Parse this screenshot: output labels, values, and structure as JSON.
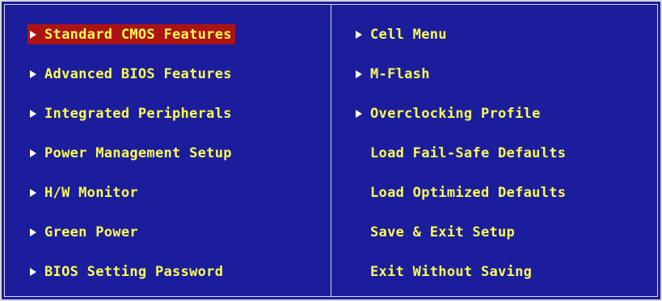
{
  "menu": {
    "left": [
      {
        "label": "Standard CMOS Features",
        "submenu": true,
        "selected": true
      },
      {
        "label": "Advanced BIOS Features",
        "submenu": true,
        "selected": false
      },
      {
        "label": "Integrated Peripherals",
        "submenu": true,
        "selected": false
      },
      {
        "label": "Power Management Setup",
        "submenu": true,
        "selected": false
      },
      {
        "label": "H/W Monitor",
        "submenu": true,
        "selected": false
      },
      {
        "label": "Green Power",
        "submenu": true,
        "selected": false
      },
      {
        "label": "BIOS Setting Password",
        "submenu": true,
        "selected": false
      }
    ],
    "right": [
      {
        "label": "Cell Menu",
        "submenu": true,
        "selected": false
      },
      {
        "label": "M-Flash",
        "submenu": true,
        "selected": false
      },
      {
        "label": "Overclocking Profile",
        "submenu": true,
        "selected": false
      },
      {
        "label": "Load Fail-Safe Defaults",
        "submenu": false,
        "selected": false
      },
      {
        "label": "Load Optimized Defaults",
        "submenu": false,
        "selected": false
      },
      {
        "label": "Save & Exit Setup",
        "submenu": false,
        "selected": false
      },
      {
        "label": "Exit Without Saving",
        "submenu": false,
        "selected": false
      }
    ]
  },
  "colors": {
    "background": "#1c1d9c",
    "text": "#fcfc54",
    "highlight": "#ae1313",
    "arrow": "#ffffff",
    "border": "#d8d8d8"
  },
  "icons": {
    "submenu_arrow": "triangle-right-icon"
  }
}
